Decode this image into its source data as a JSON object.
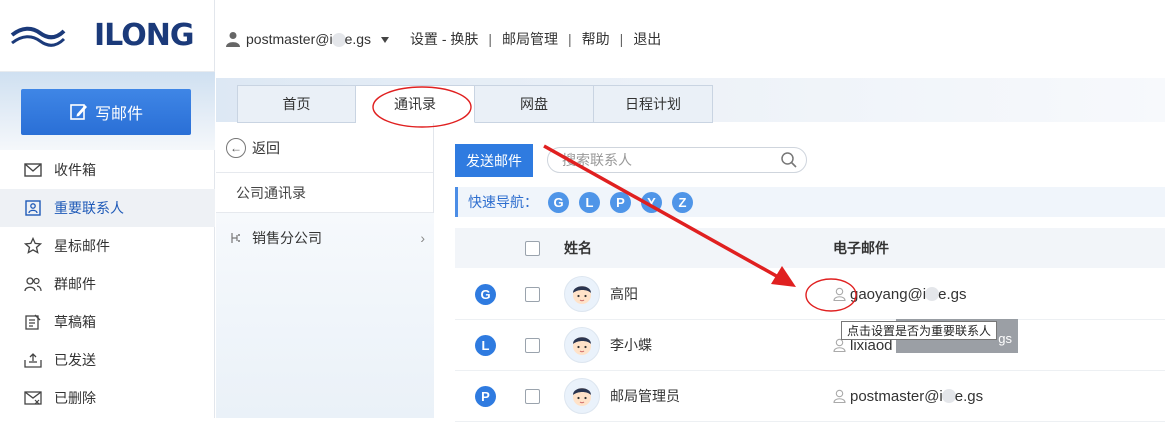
{
  "brand": {
    "logo_text": "ILONG"
  },
  "sidebar": {
    "compose_label": "写邮件",
    "items": [
      {
        "label": "收件箱",
        "icon": "inbox-icon"
      },
      {
        "label": "重要联系人",
        "icon": "contact-card-icon",
        "active": true
      },
      {
        "label": "星标邮件",
        "icon": "star-icon"
      },
      {
        "label": "群邮件",
        "icon": "group-icon"
      },
      {
        "label": "草稿箱",
        "icon": "draft-icon"
      },
      {
        "label": "已发送",
        "icon": "sent-icon"
      },
      {
        "label": "已删除",
        "icon": "deleted-icon"
      }
    ]
  },
  "topbar": {
    "user_pre": "postmaster@i",
    "user_post": "e.gs",
    "settings": "设置 - 换肤",
    "admin": "邮局管理",
    "help": "帮助",
    "logout": "退出"
  },
  "tabs": [
    {
      "label": "首页"
    },
    {
      "label": "通讯录",
      "active": true
    },
    {
      "label": "网盘"
    },
    {
      "label": "日程计划"
    }
  ],
  "groups": {
    "back_label": "返回",
    "title": "公司通讯录",
    "items": [
      {
        "label": "销售分公司"
      }
    ]
  },
  "main": {
    "send_label": "发送邮件",
    "search_placeholder": "搜索联系人",
    "quicknav_label": "快速导航：",
    "quicknav_letters": [
      "G",
      "L",
      "P",
      "Y",
      "Z"
    ],
    "col_name": "姓名",
    "col_email": "电子邮件",
    "rows": [
      {
        "letter": "G",
        "name": "高阳",
        "email_pre": "gaoyang@i",
        "email_post": "e.gs"
      },
      {
        "letter": "L",
        "name": "李小蝶",
        "email_pre": "lixiaod",
        "email_post": "gs"
      },
      {
        "letter": "P",
        "name": "邮局管理员",
        "email_pre": "postmaster@i",
        "email_post": "e.gs"
      }
    ],
    "tooltip": "点击设置是否为重要联系人"
  },
  "colors": {
    "accent": "#2f7be0",
    "annotation": "#e02020"
  }
}
